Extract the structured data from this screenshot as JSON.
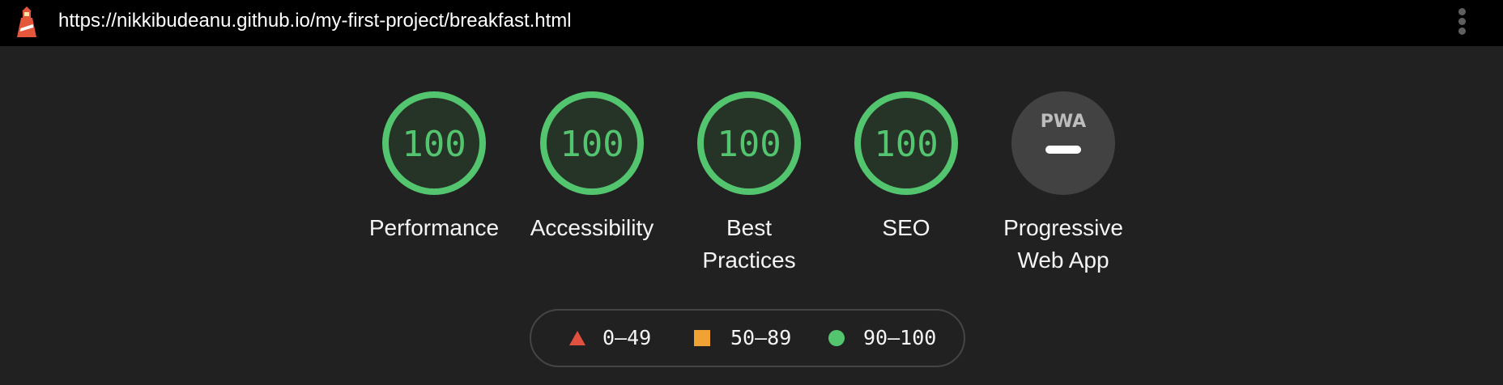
{
  "topbar": {
    "url": "https://nikkibudeanu.github.io/my-first-project/breakfast.html",
    "logo_icon": "lighthouse-icon",
    "menu_icon": "more-vert-icon"
  },
  "gauges": [
    {
      "label": "Performance",
      "score": "100",
      "status": "pass"
    },
    {
      "label": "Accessibility",
      "score": "100",
      "status": "pass"
    },
    {
      "label_line1": "Best",
      "label_line2": "Practices",
      "score": "100",
      "status": "pass"
    },
    {
      "label": "SEO",
      "score": "100",
      "status": "pass"
    },
    {
      "label_line1": "Progressive",
      "label_line2": "Web App",
      "badge_text": "PWA",
      "status": "not-applicable"
    }
  ],
  "legend": [
    {
      "range": "0–49",
      "shape": "triangle",
      "color": "#e2513f"
    },
    {
      "range": "50–89",
      "shape": "square",
      "color": "#f0a232"
    },
    {
      "range": "90–100",
      "shape": "circle",
      "color": "#54c56f"
    }
  ],
  "colors": {
    "pass": "#54c56f",
    "pass_fill": "#263427",
    "background": "#212121",
    "topbar": "#000000",
    "pwa_fill": "#424242"
  }
}
